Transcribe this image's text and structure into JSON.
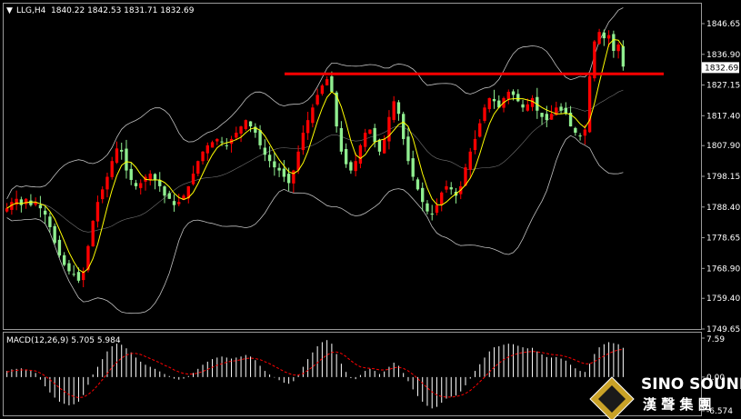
{
  "header": {
    "symbol": "LLG,H4",
    "ohlc": "1840.22 1842.53 1831.71 1832.69"
  },
  "watermark": {
    "brand": "SINO SOUND",
    "chinese": "漢 聲 集 團"
  },
  "colors": {
    "background": "#000000",
    "bull": "#FF0000",
    "bear": "#90EE90",
    "ma": "#FFFF00",
    "bands": "#C0C0C0",
    "resistance": "#FF0000",
    "macd_hist": "#FFFFFF",
    "macd_signal": "#FF0000"
  },
  "chart_data": [
    {
      "type": "candlestick",
      "title": "LLG,H4",
      "ylim": [
        1749.65,
        1853.0
      ],
      "y_ticks": [
        "1846.65",
        "1836.90",
        "1827.15",
        "1817.40",
        "1807.90",
        "1798.15",
        "1788.40",
        "1778.65",
        "1768.90",
        "1759.40",
        "1749.65"
      ],
      "current_price": "1832.69",
      "resistance_level": 1830.7,
      "indicators": [
        "Bollinger Bands",
        "Moving Average"
      ],
      "closes": [
        1788,
        1790,
        1791,
        1789,
        1791,
        1789,
        1790,
        1788,
        1786,
        1782,
        1777,
        1773,
        1770,
        1768,
        1767,
        1765,
        1768,
        1776,
        1784,
        1790,
        1794,
        1798,
        1803,
        1807,
        1806,
        1800,
        1797,
        1795,
        1796,
        1798,
        1799,
        1797,
        1795,
        1792,
        1791,
        1789,
        1790,
        1792,
        1795,
        1799,
        1803,
        1806,
        1808,
        1809,
        1810,
        1809,
        1808,
        1810,
        1812,
        1814,
        1816,
        1814,
        1812,
        1808,
        1805,
        1803,
        1801,
        1800,
        1798,
        1796,
        1800,
        1806,
        1812,
        1816,
        1820,
        1824,
        1827,
        1829,
        1825,
        1814,
        1806,
        1802,
        1800,
        1803,
        1808,
        1812,
        1813,
        1809,
        1806,
        1810,
        1817,
        1822,
        1818,
        1810,
        1803,
        1798,
        1794,
        1790,
        1787,
        1786,
        1789,
        1793,
        1795,
        1794,
        1792,
        1795,
        1801,
        1806,
        1810,
        1815,
        1820,
        1823,
        1822,
        1820,
        1823,
        1825,
        1824,
        1822,
        1820,
        1821,
        1823,
        1819,
        1817,
        1816,
        1818,
        1820,
        1819,
        1818,
        1814,
        1812,
        1811,
        1813,
        1830,
        1841,
        1844,
        1842,
        1843,
        1838,
        1840,
        1833
      ]
    },
    {
      "type": "macd",
      "label": "MACD(12,26,9) 5.705 5.984",
      "ylim": [
        -6.574,
        7.59
      ],
      "y_ticks": [
        "7.59",
        "0.00",
        "-6.574"
      ],
      "histogram": [
        1.2,
        1.5,
        1.6,
        1.7,
        1.5,
        1.2,
        0.8,
        -0.5,
        -1.8,
        -3.0,
        -4.0,
        -4.8,
        -5.2,
        -5.5,
        -5.3,
        -4.8,
        -3.5,
        -1.5,
        0.5,
        2.0,
        3.5,
        5.0,
        6.0,
        6.5,
        6.3,
        5.6,
        4.8,
        3.8,
        3.0,
        2.4,
        2.0,
        1.6,
        1.1,
        0.6,
        0.2,
        -0.3,
        -0.5,
        -0.3,
        0.2,
        0.8,
        1.6,
        2.4,
        3.0,
        3.5,
        3.8,
        4.0,
        3.8,
        3.6,
        3.8,
        4.0,
        4.3,
        4.0,
        3.3,
        2.2,
        1.2,
        0.5,
        -0.1,
        -0.6,
        -1.1,
        -1.3,
        -0.8,
        0.5,
        2.0,
        3.5,
        4.8,
        6.0,
        6.8,
        7.2,
        6.5,
        4.5,
        2.6,
        1.0,
        -0.2,
        -0.4,
        0.4,
        1.2,
        1.6,
        1.2,
        0.6,
        1.1,
        2.0,
        2.8,
        2.2,
        0.8,
        -0.8,
        -2.4,
        -3.7,
        -4.8,
        -5.6,
        -6.1,
        -5.8,
        -5.0,
        -4.2,
        -3.8,
        -3.6,
        -2.8,
        -1.6,
        -0.3,
        1.2,
        2.5,
        3.8,
        5.0,
        5.8,
        6.0,
        6.3,
        6.5,
        6.4,
        6.1,
        5.8,
        5.6,
        5.7,
        5.0,
        4.4,
        3.9,
        3.8,
        3.9,
        3.6,
        3.2,
        2.4,
        1.7,
        1.2,
        1.0,
        2.6,
        4.5,
        5.8,
        6.4,
        6.8,
        6.6,
        6.4,
        5.7
      ],
      "signal": [
        1.0,
        1.2,
        1.3,
        1.4,
        1.4,
        1.3,
        1.2,
        0.8,
        0.2,
        -0.5,
        -1.3,
        -2.1,
        -2.8,
        -3.4,
        -3.8,
        -4.0,
        -3.9,
        -3.4,
        -2.6,
        -1.6,
        -0.5,
        0.7,
        1.9,
        2.9,
        3.7,
        4.3,
        4.6,
        4.6,
        4.4,
        4.0,
        3.6,
        3.2,
        2.8,
        2.3,
        1.9,
        1.4,
        1.0,
        0.7,
        0.6,
        0.6,
        0.8,
        1.1,
        1.5,
        1.9,
        2.3,
        2.6,
        2.9,
        3.1,
        3.2,
        3.4,
        3.6,
        3.7,
        3.6,
        3.4,
        3.0,
        2.6,
        2.1,
        1.6,
        1.1,
        0.7,
        0.4,
        0.4,
        0.7,
        1.3,
        2.0,
        2.8,
        3.6,
        4.3,
        4.8,
        4.9,
        4.6,
        4.0,
        3.2,
        2.5,
        2.0,
        1.8,
        1.7,
        1.6,
        1.4,
        1.4,
        1.5,
        1.8,
        1.9,
        1.7,
        1.2,
        0.5,
        -0.3,
        -1.2,
        -2.1,
        -2.9,
        -3.5,
        -3.8,
        -3.9,
        -3.9,
        -3.8,
        -3.6,
        -3.2,
        -2.6,
        -1.8,
        -0.9,
        0.0,
        1.0,
        1.9,
        2.7,
        3.4,
        3.9,
        4.3,
        4.6,
        4.8,
        4.9,
        5.0,
        4.9,
        4.8,
        4.6,
        4.4,
        4.3,
        4.2,
        4.0,
        3.7,
        3.3,
        2.9,
        2.6,
        2.6,
        3.0,
        3.6,
        4.1,
        4.6,
        5.0,
        5.3,
        5.4
      ]
    }
  ]
}
